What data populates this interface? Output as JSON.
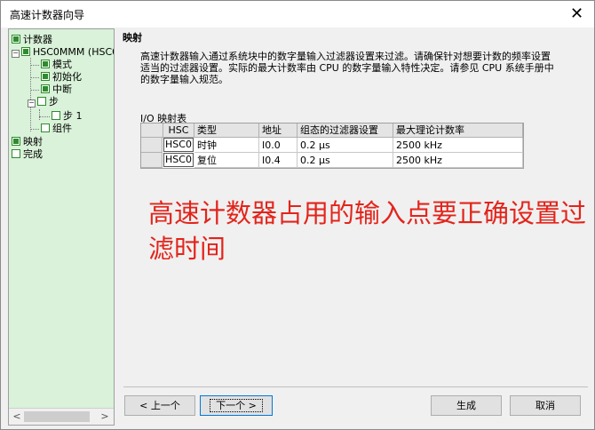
{
  "window": {
    "title": "高速计数器向导",
    "close": "✕"
  },
  "tree": {
    "items": [
      {
        "label": "计数器",
        "checked": true
      },
      {
        "label": "HSC0MMM (HSC0",
        "checked": true
      },
      {
        "label": "模式",
        "checked": true
      },
      {
        "label": "初始化",
        "checked": true
      },
      {
        "label": "中断",
        "checked": true
      },
      {
        "label": "步",
        "checked": false
      },
      {
        "label": "步 1",
        "checked": false
      },
      {
        "label": "组件",
        "checked": false
      },
      {
        "label": "映射",
        "checked": true
      },
      {
        "label": "完成",
        "checked": false
      }
    ],
    "scroll_left": "<",
    "scroll_right": ">"
  },
  "content": {
    "section_title": "映射",
    "description": "高速计数器输入通过系统块中的数字量输入过滤器设置来过滤。请确保针对想要计数的频率设置适当的过滤器设置。实际的最大计数率由 CPU 的数字量输入特性决定。请参见 CPU 系统手册中的数字量输入规范。",
    "io_table_title": "I/O 映射表",
    "io_table": {
      "headers": [
        "HSC",
        "类型",
        "地址",
        "组态的过滤器设置",
        "最大理论计数率"
      ],
      "rows": [
        {
          "hsc": "HSC0",
          "type": "时钟",
          "address": "I0.0",
          "filter": "0.2 µs",
          "max_rate": "2500 kHz"
        },
        {
          "hsc": "HSC0",
          "type": "复位",
          "address": "I0.4",
          "filter": "0.2 µs",
          "max_rate": "2500 kHz"
        }
      ]
    },
    "annotation": "高速计数器占用的输入点要正确设置过滤时间"
  },
  "buttons": {
    "prev": "< 上一个",
    "next": "下一个 >",
    "generate": "生成",
    "cancel": "取消"
  },
  "colors": {
    "tree_bg": "#d9f2d9",
    "annotation": "#e3241b",
    "checkbox": "#2e8b2e"
  }
}
